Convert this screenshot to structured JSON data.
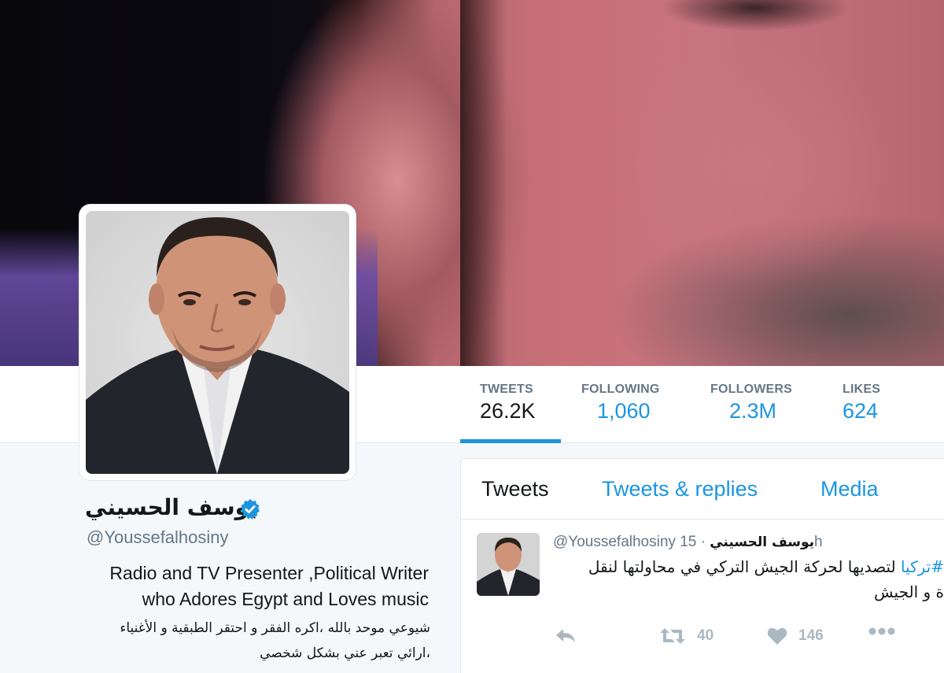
{
  "banner": {
    "alt": "header-photo"
  },
  "profile": {
    "name": "يوسف الحسيني",
    "handle": "@Youssefalhosiny",
    "bio_line1": "Radio and TV Presenter ,Political Writer",
    "bio_line2": "who Adores Egypt and Loves music",
    "bio_ar_line1": "شيوعي موحد بالله ،اكره الفقر و احتقر الطبقية و الأغنياء",
    "bio_ar_line2": "،ارائي تعبر عني بشكل شخصي"
  },
  "stats": [
    {
      "label": "TWEETS",
      "value": "26.2K"
    },
    {
      "label": "FOLLOWING",
      "value": "1,060"
    },
    {
      "label": "FOLLOWERS",
      "value": "2.3M"
    },
    {
      "label": "LIKES",
      "value": "624"
    }
  ],
  "tabs": {
    "tweets": "Tweets",
    "replies": "Tweets & replies",
    "media": "Media"
  },
  "tweet": {
    "name": "يوسف الحسيني",
    "handle": "@Youssefalhosiny",
    "time": "· 15h",
    "hashtag": "#تركيا",
    "text_line1": "لتصديها لحركة الجيش التركي في محاولتها لنقل",
    "text_line2": "ة و الجيش",
    "retweets": "40",
    "likes": "146"
  },
  "colors": {
    "accent": "#1b95e0",
    "muted": "#657786",
    "text": "#14171a",
    "background": "#f5f8fa"
  }
}
